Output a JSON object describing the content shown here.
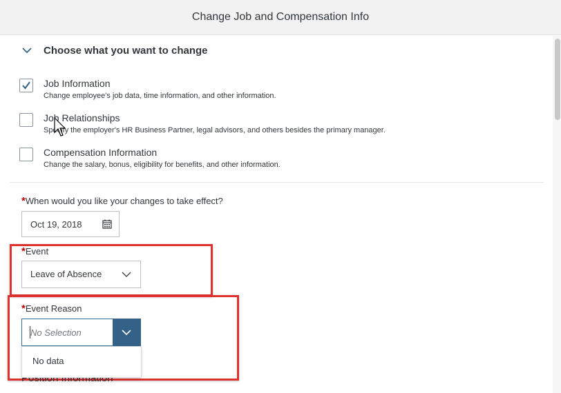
{
  "dialog": {
    "title": "Change Job and Compensation Info"
  },
  "section": {
    "title": "Choose what you want to change"
  },
  "options": [
    {
      "label": "Job Information",
      "description": "Change employee's job data, time information, and other information.",
      "checked": true
    },
    {
      "label": "Job Relationships",
      "description": "Specify the employer's HR Business Partner, legal advisors, and others besides the primary manager.",
      "checked": false
    },
    {
      "label": "Compensation Information",
      "description": "Change the salary, bonus, eligibility for benefits, and other information.",
      "checked": false
    }
  ],
  "effective_date": {
    "required_mark": "*",
    "label": "When would you like your changes to take effect?",
    "value": "Oct 19, 2018"
  },
  "event": {
    "required_mark": "*",
    "label": "Event",
    "value": "Leave of Absence"
  },
  "event_reason": {
    "required_mark": "*",
    "label": "Event Reason",
    "placeholder": "No Selection",
    "dropdown_item": "No data"
  },
  "next_section": {
    "title": "Position Information"
  },
  "colors": {
    "accent": "#346187",
    "required": "#bb0000",
    "highlight": "#e03131"
  }
}
